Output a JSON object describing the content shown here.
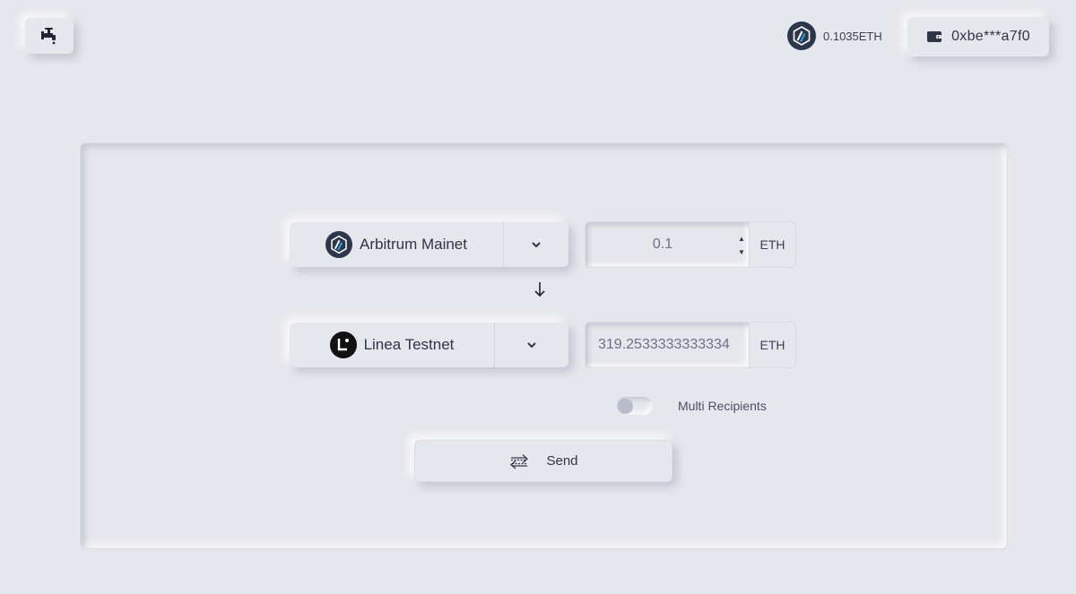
{
  "header": {
    "faucet_icon": "faucet-icon",
    "balance": {
      "icon": "arbitrum-logo-icon",
      "value": "0.1035ETH"
    },
    "wallet": {
      "icon": "wallet-icon",
      "address": "0xbe***a7f0"
    }
  },
  "bridge": {
    "source": {
      "chain_label": "Arbitrum Mainet",
      "chain_icon": "arbitrum-logo-icon",
      "amount_value": "0.1",
      "unit": "ETH"
    },
    "direction_icon": "arrow-down-icon",
    "destination": {
      "chain_label": "Linea Testnet",
      "chain_icon": "linea-logo-icon",
      "amount_value": "319.2533333333334",
      "unit": "ETH"
    },
    "multi_recipients": {
      "label": "Multi Recipients",
      "enabled": false
    },
    "send": {
      "label": "Send",
      "icon": "swap-arrows-icon"
    }
  },
  "colors": {
    "background": "#e6e7ec",
    "text_primary": "#2f3448",
    "arbitrum_dark": "#2d374b",
    "arbitrum_blue": "#28a0f0",
    "linea_dark": "#121212",
    "toggle_knob": "#b9bdcb"
  }
}
